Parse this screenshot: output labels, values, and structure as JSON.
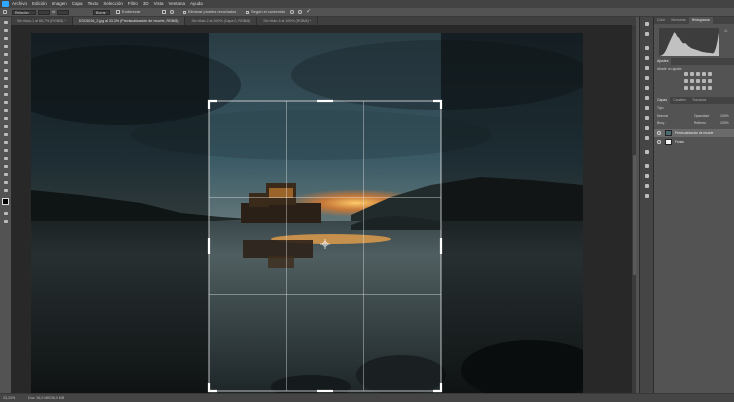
{
  "menu": {
    "items": [
      "Archivo",
      "Edición",
      "Imagen",
      "Capa",
      "Texto",
      "Selección",
      "Filtro",
      "3D",
      "Vista",
      "Ventana",
      "Ayuda"
    ]
  },
  "options": {
    "ratio_value": "Relación",
    "field1": "",
    "field2": "",
    "clear_label": "Borrar",
    "straighten_label": "Enderezar",
    "delete_cropped_label": "Eliminar píxeles recortados",
    "content_aware_label": "Según el contenido"
  },
  "tabs": [
    "Sin título-1 al 66,7% (RGB/8) *",
    "DSC6016_2.jpg al 33,3% (Previsualización de recorte, RGB/8)",
    "Sin título-2 al 100% (Capa 0, RGB/8)",
    "Sin título-3 al 100% (RGB/8) *"
  ],
  "status": {
    "zoom": "33,33%",
    "doc": "Doc: 36,0 MB/36,0 MB"
  },
  "panels": {
    "top_tabs": [
      "Color",
      "Muestras",
      "Histograma"
    ],
    "adjust_tabs": [
      "Ajustes"
    ],
    "adjust_label": "Añadir un ajuste",
    "layers_tabs": [
      "Capas",
      "Canales",
      "Trazados"
    ],
    "kind": "Tipo",
    "blend": "Normal",
    "opacity_label": "Opacidad:",
    "opacity_value": "100%",
    "lock_label": "Bloq.:",
    "fill_label": "Relleno:",
    "fill_value": "100%",
    "layers": [
      {
        "name": "Previsualización de recorte"
      },
      {
        "name": "Fondo"
      }
    ]
  },
  "chart_data": {
    "type": "area",
    "title": "",
    "x": [
      0,
      1,
      2,
      3,
      4,
      5,
      6,
      7,
      8,
      9,
      10,
      11,
      12,
      13,
      14,
      15,
      16,
      17,
      18,
      19,
      20,
      21,
      22,
      23,
      24,
      25,
      26,
      27,
      28,
      29,
      30,
      31,
      32,
      33,
      34,
      35,
      36,
      37,
      38,
      39
    ],
    "values": [
      0,
      1,
      3,
      8,
      16,
      28,
      42,
      55,
      68,
      80,
      92,
      85,
      74,
      70,
      60,
      52,
      48,
      50,
      44,
      38,
      34,
      30,
      28,
      26,
      24,
      22,
      20,
      18,
      16,
      15,
      14,
      13,
      12,
      12,
      11,
      10,
      14,
      30,
      55,
      90
    ],
    "ylim": [
      0,
      100
    ]
  }
}
